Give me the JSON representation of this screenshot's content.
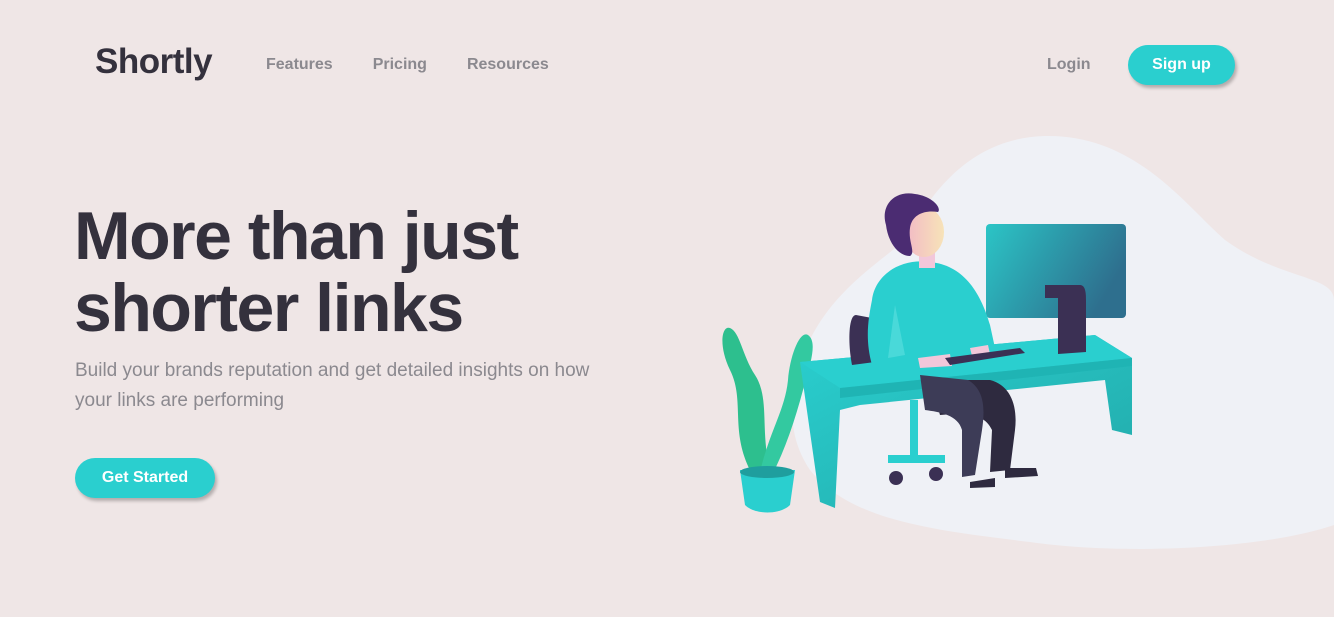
{
  "brand": {
    "logo": "Shortly"
  },
  "nav": {
    "links": [
      "Features",
      "Pricing",
      "Resources"
    ]
  },
  "auth": {
    "login": "Login",
    "signup": "Sign up"
  },
  "hero": {
    "title_line1": "More than just",
    "title_line2": "shorter links",
    "subtitle_line1": "Build your brands reputation and get detailed insights on how",
    "subtitle_line2": "your links are performing",
    "cta": "Get Started"
  },
  "colors": {
    "background": "#EFE6E6",
    "accent": "#2ACFCF",
    "heading": "#34313D",
    "muted": "#8B898F"
  },
  "illustration": {
    "icon": "person-working-at-desk-illustration"
  }
}
